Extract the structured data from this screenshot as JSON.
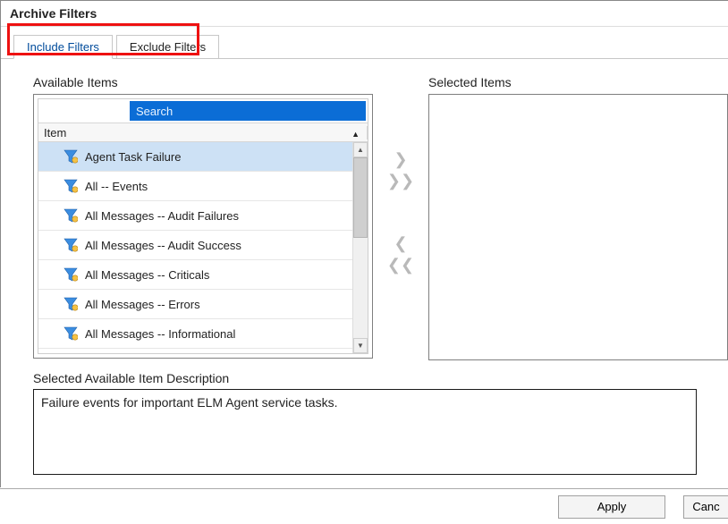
{
  "header": {
    "title": "Archive Filters"
  },
  "tabs": [
    {
      "label": "Include Filters",
      "active": true
    },
    {
      "label": "Exclude Filters",
      "active": false
    }
  ],
  "available": {
    "title": "Available Items",
    "search_placeholder": "Search",
    "column_header": "Item",
    "items": [
      {
        "label": "Agent Task Failure",
        "selected": true
      },
      {
        "label": "All -- Events"
      },
      {
        "label": "All Messages -- Audit Failures"
      },
      {
        "label": "All Messages -- Audit Success"
      },
      {
        "label": "All Messages -- Criticals"
      },
      {
        "label": "All Messages -- Errors"
      },
      {
        "label": "All Messages -- Informational"
      }
    ]
  },
  "selected": {
    "title": "Selected Items"
  },
  "description": {
    "title": "Selected Available Item Description",
    "text": "Failure events for important ELM Agent service tasks."
  },
  "buttons": {
    "apply": "Apply",
    "cancel": "Canc"
  }
}
